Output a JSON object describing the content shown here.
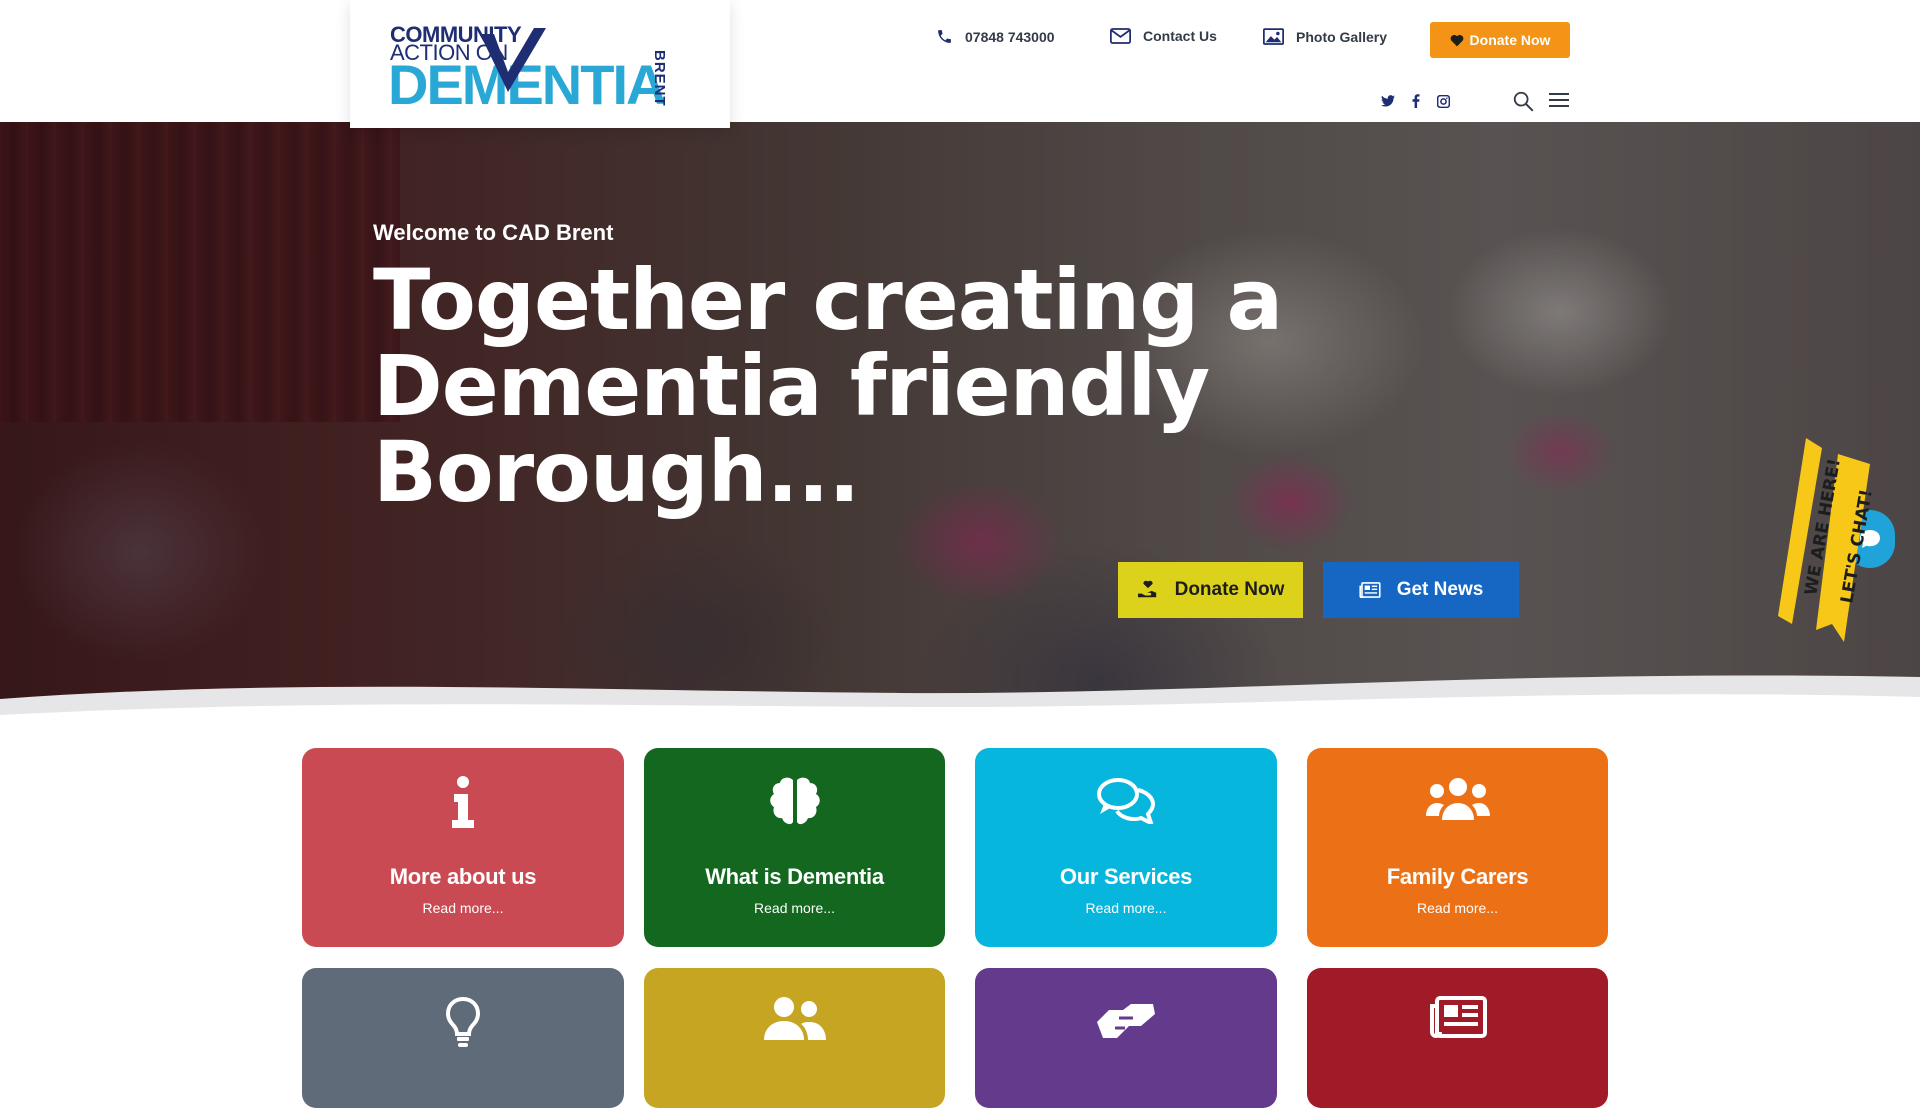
{
  "header": {
    "logo": {
      "line1": "COMMUNITY",
      "line2": "ACTION ON",
      "line3": "DEMENTIA",
      "tag": "BRENT"
    },
    "phone": "07848 743000",
    "contact": "Contact Us",
    "gallery": "Photo Gallery",
    "donate_label": "Donate Now",
    "icons": [
      "phone-icon",
      "envelope-icon",
      "image-icon",
      "heart-icon",
      "twitter-icon",
      "facebook-icon",
      "instagram-icon",
      "search-icon",
      "menu-icon"
    ]
  },
  "hero": {
    "welcome": "Welcome to CAD Brent",
    "title_lines": [
      "Together creating a",
      "Dementia friendly",
      "Borough..."
    ],
    "donate_label": "Donate Now",
    "news_label": "Get News",
    "chat_ribbon": {
      "line1": "WE ARE HERE!",
      "line2": "LET'S CHAT!"
    }
  },
  "tiles": [
    {
      "title": "More about us",
      "link": "Read more...",
      "color": "#c94a52",
      "icon": "info-icon"
    },
    {
      "title": "What is Dementia",
      "link": "Read more...",
      "color": "#13671f",
      "icon": "brain-icon"
    },
    {
      "title": "Our Services",
      "link": "Read more...",
      "color": "#06b6dd",
      "icon": "comments-icon"
    },
    {
      "title": "Family Carers",
      "link": "Read more...",
      "color": "#ec7116",
      "icon": "users-icon"
    },
    {
      "title": "",
      "link": "",
      "color": "#5f6b79",
      "icon": "lightbulb-icon"
    },
    {
      "title": "",
      "link": "",
      "color": "#c6a522",
      "icon": "user-friends-icon"
    },
    {
      "title": "",
      "link": "",
      "color": "#643a8d",
      "icon": "handshake-icon"
    },
    {
      "title": "",
      "link": "",
      "color": "#a01a27",
      "icon": "newspaper-icon"
    }
  ],
  "colors": {
    "brand_navy": "#1f2d72",
    "brand_blue": "#29a8d6",
    "donate_orange": "#f39416",
    "hero_yellow": "#ddd21b",
    "hero_blue": "#1667c4"
  }
}
